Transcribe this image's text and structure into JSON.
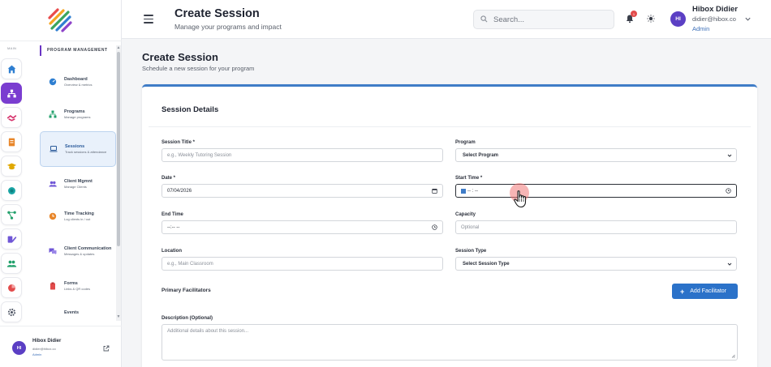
{
  "sidebar": {
    "main_label": "MAIN",
    "section_header": "PROGRAM MANAGEMENT",
    "rail_icons": [
      "home-icon",
      "programs-icon",
      "handshake-icon",
      "forms-icon",
      "courses-icon",
      "globe-icon",
      "network-icon",
      "edit-icon",
      "users-icon",
      "reports-icon",
      "settings-icon"
    ],
    "items": [
      {
        "title": "Dashboard",
        "sub": "Overview & metrics"
      },
      {
        "title": "Programs",
        "sub": "Manage programs"
      },
      {
        "title": "Sessions",
        "sub": "Track sessions & attendance"
      },
      {
        "title": "Client Mgmnt",
        "sub": "Manage Clients"
      },
      {
        "title": "Time Tracking",
        "sub": "Log clients in / out"
      },
      {
        "title": "Client Communication",
        "sub": "Messages & updates"
      },
      {
        "title": "Forms",
        "sub": "Links & QR codes"
      },
      {
        "title": "Events",
        "sub": ""
      }
    ],
    "user": {
      "initials": "HI",
      "name": "Hibox Didier",
      "email": "didier@hibox.co",
      "role": "Admin"
    }
  },
  "topbar": {
    "title": "Create Session",
    "subtitle": "Manage your programs and impact",
    "search_placeholder": "Search...",
    "notification_count": "1",
    "user": {
      "initials": "HI",
      "name": "Hibox Didier",
      "email": "didier@hibox.co",
      "role": "Admin"
    }
  },
  "page": {
    "title": "Create Session",
    "subtitle": "Schedule a new session for your program"
  },
  "form": {
    "section_title": "Session Details",
    "session_title_label": "Session Title *",
    "session_title_placeholder": "e.g., Weekly Tutoring Session",
    "program_label": "Program",
    "program_value": "Select Program",
    "date_label": "Date *",
    "date_value": "07/04/2026",
    "start_time_label": "Start Time *",
    "start_time_value": "-- : --",
    "end_time_label": "End Time",
    "end_time_value": "--:-- --",
    "capacity_label": "Capacity",
    "capacity_placeholder": "Optional",
    "location_label": "Location",
    "location_placeholder": "e.g., Main Classroom",
    "session_type_label": "Session Type",
    "session_type_value": "Select Session Type",
    "facilitators_label": "Primary Facilitators",
    "add_facilitator_label": "Add Facilitator",
    "description_label": "Description (Optional)",
    "description_placeholder": "Additional details about this session..."
  },
  "colors": {
    "accent": "#2b72c9",
    "brand": "#7a3dd0",
    "active_nav": "#e9f1fb"
  }
}
